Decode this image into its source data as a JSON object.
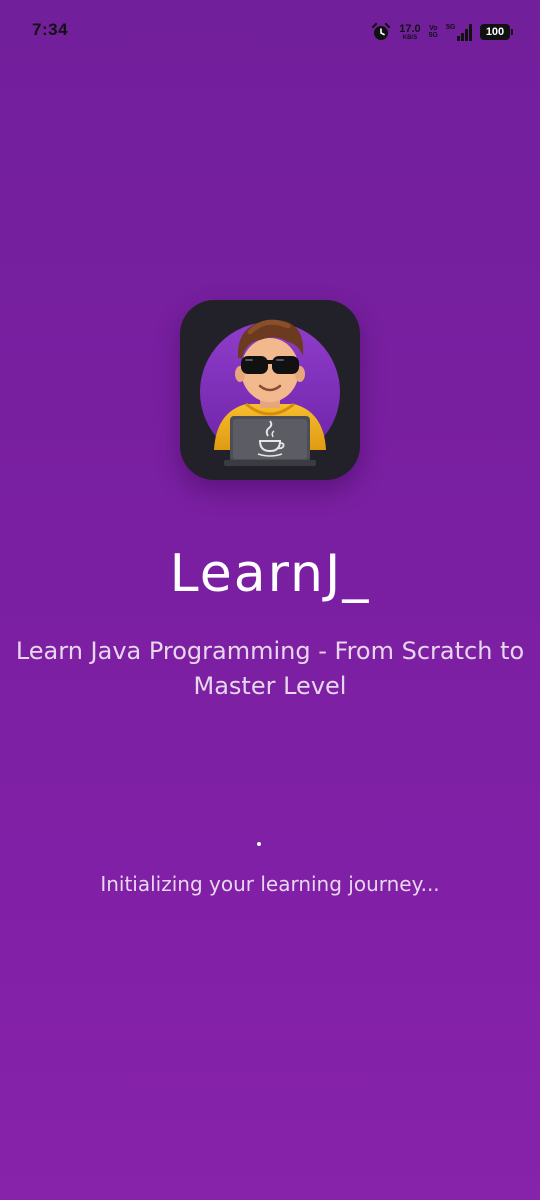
{
  "status_bar": {
    "time": "7:34",
    "net_speed_value": "17.0",
    "net_speed_unit": "KB/S",
    "volte_top": "Vo",
    "volte_bottom": "5G",
    "network_type": "5G",
    "battery_level": "100"
  },
  "splash": {
    "app_title": "LearnJ_",
    "tagline": "Learn Java Programming - From Scratch to Master Level",
    "loading_text": "Initializing your learning journey...",
    "icons": {
      "app_logo": "developer-avatar-with-laptop",
      "alarm": "alarm-clock-icon",
      "signal": "cellular-signal-icon",
      "battery": "battery-icon"
    },
    "colors": {
      "background_top": "#721f9c",
      "background_bottom": "#8722ab",
      "icon_background": "#22212a",
      "hoodie": "#f3b323"
    }
  }
}
